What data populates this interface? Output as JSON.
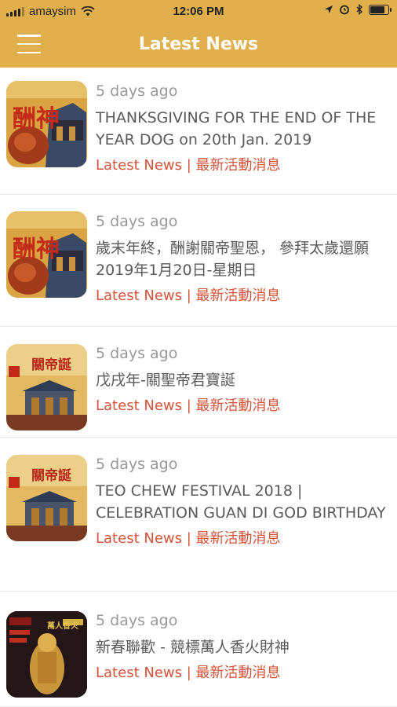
{
  "status_bar": {
    "carrier": "amaysim",
    "time": "12:06 PM",
    "battery_level": 0.85
  },
  "header": {
    "title": "Latest News",
    "menu_icon": "hamburger-icon"
  },
  "colors": {
    "header_bg": "#e1b04c",
    "category_text": "#d4533a",
    "time_text": "#999999"
  },
  "articles": [
    {
      "time": "5 days ago",
      "title": "THANKSGIVING FOR THE END OF THE YEAR DOG on 20th Jan. 2019",
      "category": "Latest News | 最新活動消息",
      "thumb_text": "酬神"
    },
    {
      "time": "5 days ago",
      "title": "歲末年終，酬謝關帝聖恩， 參拜太歲還願 2019年1月20日-星期日",
      "category": "Latest News | 最新活動消息",
      "thumb_text": "酬神"
    },
    {
      "time": "5 days ago",
      "title": "戊戌年-關聖帝君寶誕",
      "category": "Latest News | 最新活動消息",
      "thumb_text": "關帝誕"
    },
    {
      "time": "5 days ago",
      "title": "TEO CHEW FESTIVAL 2018 | CELEBRATION GUAN DI GOD BIRTHDAY",
      "category": "Latest News | 最新活動消息",
      "thumb_text": "關帝誕"
    },
    {
      "time": "5 days ago",
      "title": "新春聯歡 - 競標萬人香火財神",
      "category": "Latest News | 最新活動消息",
      "thumb_text": "萬人香火"
    }
  ]
}
